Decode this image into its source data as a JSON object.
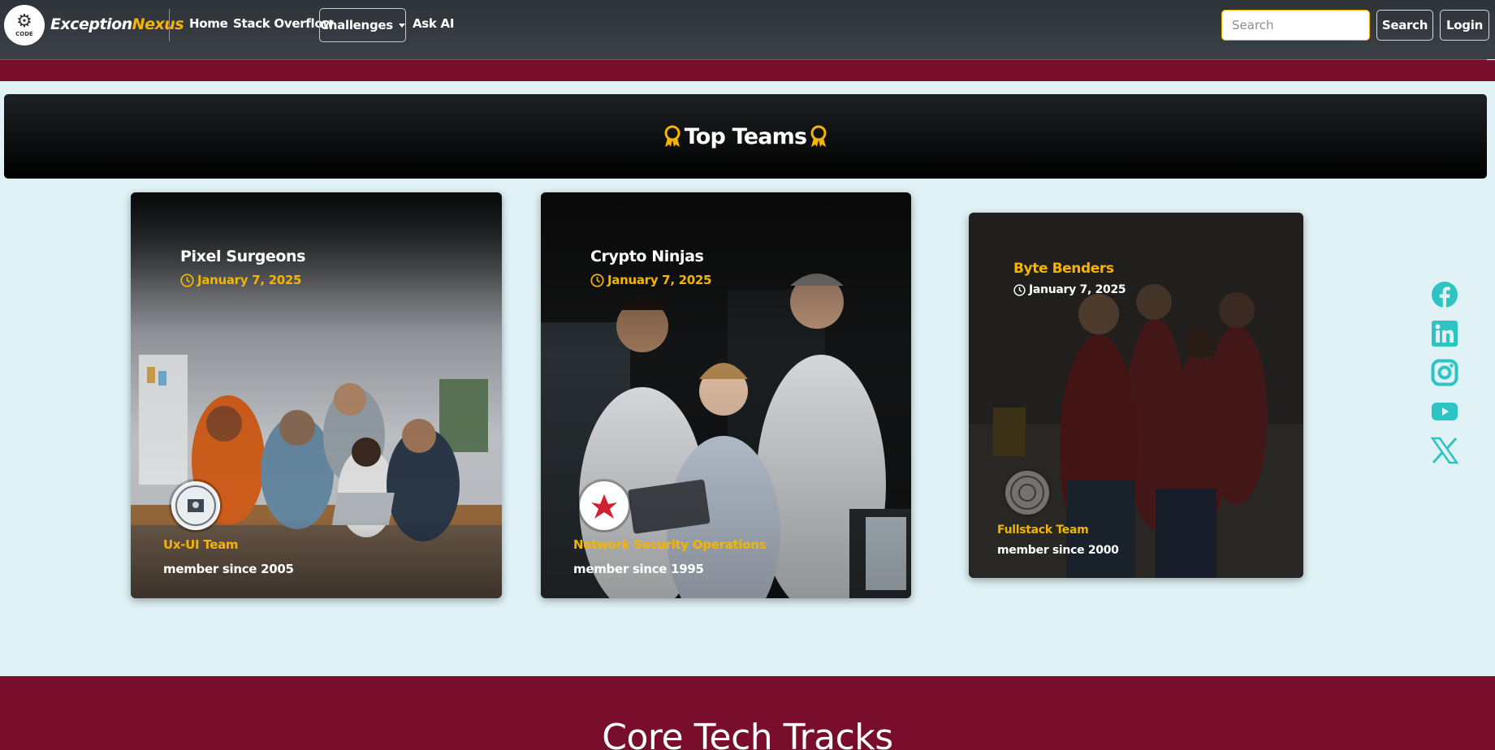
{
  "brand": {
    "name_part1": "Exception",
    "name_part2": "Nexus",
    "logo_caption": "CODE"
  },
  "nav": {
    "home": "Home",
    "stack_overflow": "Stack Overflow",
    "challenges": "Challenges",
    "ask_ai": "Ask AI"
  },
  "search": {
    "placeholder": "Search",
    "button": "Search"
  },
  "login": "Login",
  "banner": {
    "title": "Top Teams"
  },
  "cards": [
    {
      "title": "Pixel Surgeons",
      "date": "January 7, 2025",
      "team": "Ux-UI Team",
      "since": "member since 2005"
    },
    {
      "title": "Crypto Ninjas",
      "date": "January 7, 2025",
      "team": "Network Security Operations",
      "since": "member since 1995"
    },
    {
      "title": "Byte Benders",
      "date": "January 7, 2025",
      "team": "Fullstack Team",
      "since": "member since 2000"
    }
  ],
  "social": [
    "facebook-icon",
    "linkedin-icon",
    "instagram-icon",
    "youtube-icon",
    "x-icon"
  ],
  "section": {
    "title": "Core Tech Tracks"
  },
  "colors": {
    "accent": "#f5b400",
    "crimson": "#780d2c",
    "teal": "#2ec4c4",
    "page_bg": "#e0f2f5"
  }
}
